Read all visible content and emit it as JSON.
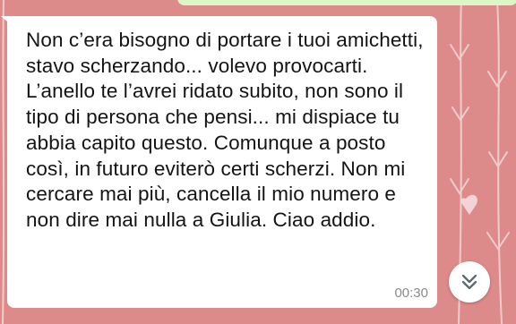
{
  "conversation": {
    "message": {
      "text": "Non c’era bisogno di portare i tuoi amichetti, stavo scherzando... volevo provocarti. L’anello te l’avrei ridato subito, non sono il tipo di persona che pensi... mi dispiace tu abbia capito questo. Comunque a posto così, in futuro eviterò certi scherzi. Non mi cercare mai più, cancella il mio numero e non dire mai nulla a Giulia. Ciao addio.",
      "time": "00:30"
    }
  },
  "controls": {
    "scroll_down_icon": "double-chevron-down-icon"
  },
  "colors": {
    "wallpaper": "#dd8a8a",
    "incoming_bubble": "#ffffff",
    "outgoing_bubble": "#dcf7c5",
    "text": "#141414",
    "timestamp": "#8a8a8a"
  }
}
